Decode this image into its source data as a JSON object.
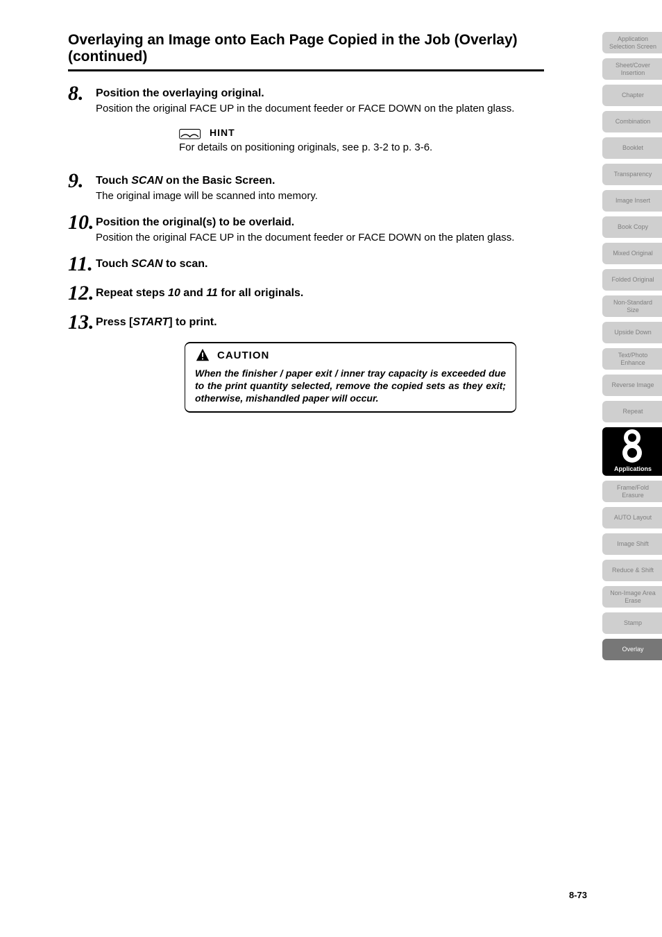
{
  "title": "Overlaying an Image onto Each Page Copied in the Job (Overlay) (continued)",
  "steps": {
    "s8": {
      "num": "8.",
      "heading": "Position the overlaying original.",
      "detail": "Position the original FACE UP in the document feeder or FACE DOWN on the platen glass."
    },
    "hint": {
      "label": "HINT",
      "text": "For details on positioning originals, see p. 3-2 to p. 3-6."
    },
    "s9": {
      "num": "9.",
      "heading_pre": "Touch ",
      "heading_em": "SCAN",
      "heading_post": " on the Basic Screen.",
      "detail": "The original image will be scanned into memory."
    },
    "s10": {
      "num": "10.",
      "heading": "Position the original(s) to be overlaid.",
      "detail": "Position the original FACE UP in the document feeder or FACE DOWN on the platen glass."
    },
    "s11": {
      "num": "11.",
      "heading_pre": "Touch ",
      "heading_em": "SCAN",
      "heading_post": " to scan."
    },
    "s12": {
      "num": "12.",
      "heading_pre": "Repeat steps ",
      "heading_em1": "10",
      "heading_mid": " and ",
      "heading_em2": "11",
      "heading_post": " for all originals."
    },
    "s13": {
      "num": "13.",
      "heading_pre": "Press [",
      "heading_em": "START",
      "heading_post": "] to print."
    }
  },
  "caution": {
    "label": "CAUTION",
    "text": "When the finisher / paper exit / inner tray capacity is exceeded due to the print quantity selected, remove the copied sets as they exit; otherwise, mishandled paper will occur."
  },
  "sidebar": {
    "items": [
      "Application Selection Screen",
      "Sheet/Cover Insertion",
      "Chapter",
      "Combination",
      "Booklet",
      "Transparency",
      "Image Insert",
      "Book Copy",
      "Mixed Original",
      "Folded Original",
      "Non-Standard Size",
      "Upside Down",
      "Text/Photo Enhance",
      "Reverse Image",
      "Repeat"
    ],
    "applications": {
      "num": "8",
      "label": "Applications"
    },
    "items2": [
      "Frame/Fold Erasure",
      "AUTO Layout",
      "Image Shift",
      "Reduce & Shift",
      "Non-Image Area Erase",
      "Stamp"
    ],
    "overlay": "Overlay"
  },
  "page_number": "8-73"
}
